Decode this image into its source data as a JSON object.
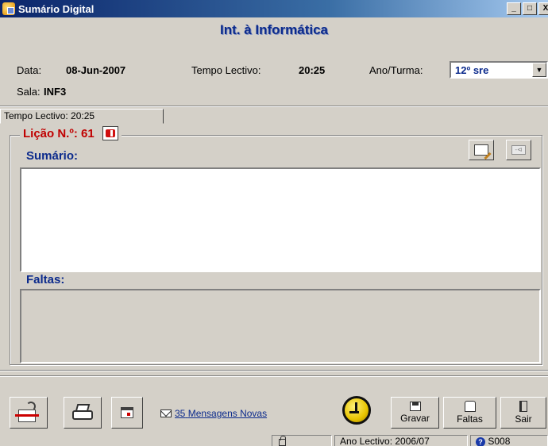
{
  "window": {
    "title": "Sumário Digital",
    "controls": [
      "_",
      "□",
      "X"
    ]
  },
  "header": {
    "course": "Int. à Informática",
    "date_label": "Data:",
    "date_value": "08-Jun-2007",
    "tempo_label": "Tempo Lectivo:",
    "tempo_value": "20:25",
    "turma_label": "Ano/Turma:",
    "turma_value": "12º sre",
    "sala_label": "Sala:",
    "sala_value": "INF3"
  },
  "tab": {
    "label": "Tempo Lectivo: 20:25"
  },
  "lesson": {
    "title": "Lição N.º: 61",
    "summary_label": "Sumário:",
    "summary_text": "",
    "absences_label": "Faltas:"
  },
  "bottom": {
    "messages_count": "35",
    "messages_text": "Mensagens Novas",
    "save_label": "Gravar",
    "faltas_label": "Faltas",
    "exit_label": "Sair"
  },
  "status": {
    "year": "Ano Lectivo: 2006/07",
    "user": "S008"
  },
  "icons": {
    "app": "app-icon",
    "lesson": "red-book-icon",
    "edit": "edit-icon",
    "exit_doc": "exit-doc-icon",
    "network": "network-icon",
    "printer": "printer-icon",
    "calendar": "calendar-icon",
    "mail": "mail-icon",
    "clock": "clock-icon",
    "save": "floppy-icon",
    "faltas": "clip-icon",
    "exit": "door-icon",
    "help": "help-icon",
    "lock": "lock-icon"
  },
  "colors": {
    "title_blue": "#0b2a8c",
    "lesson_red": "#c00000",
    "window_bg": "#d4d0c8"
  }
}
